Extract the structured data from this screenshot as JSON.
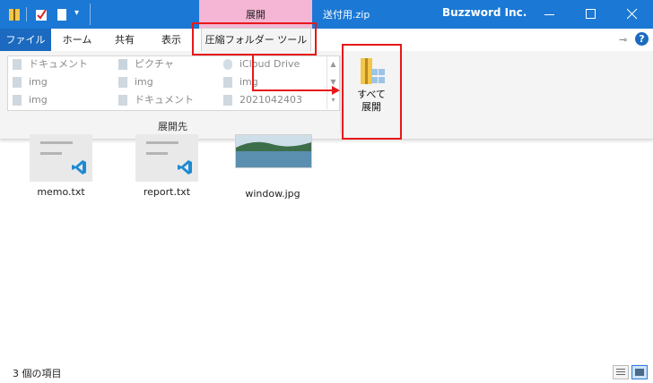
{
  "titlebar": {
    "context_tab": "展開",
    "title": "送付用.zip",
    "brand": "Buzzword Inc.",
    "accent": "#1b78d4",
    "context_color": "#f4b6d4"
  },
  "ribbon_tabs": {
    "file": "ファイル",
    "home": "ホーム",
    "share": "共有",
    "view": "表示",
    "compressed_tools": "圧縮フォルダー ツール"
  },
  "extract_to": {
    "items": [
      {
        "label": "ドキュメント",
        "icon": "document-icon"
      },
      {
        "label": "ピクチャ",
        "icon": "pictures-icon"
      },
      {
        "label": "iCloud Drive",
        "icon": "cloud-icon"
      },
      {
        "label": "img",
        "icon": "folder-icon"
      },
      {
        "label": "img",
        "icon": "folder-icon"
      },
      {
        "label": "img",
        "icon": "folder-icon"
      },
      {
        "label": "img",
        "icon": "folder-icon"
      },
      {
        "label": "ドキュメント",
        "icon": "folder-icon"
      },
      {
        "label": "2021042403",
        "icon": "folder-icon"
      }
    ],
    "group_label": "展開先"
  },
  "extract_all": {
    "line1": "すべて",
    "line2": "展開"
  },
  "files": [
    {
      "name": "memo.txt",
      "icon": "vscode-icon"
    },
    {
      "name": "report.txt",
      "icon": "vscode-icon"
    },
    {
      "name": "window.jpg",
      "icon": "image-thumbnail"
    }
  ],
  "statusbar": {
    "count": "3 個の項目"
  }
}
